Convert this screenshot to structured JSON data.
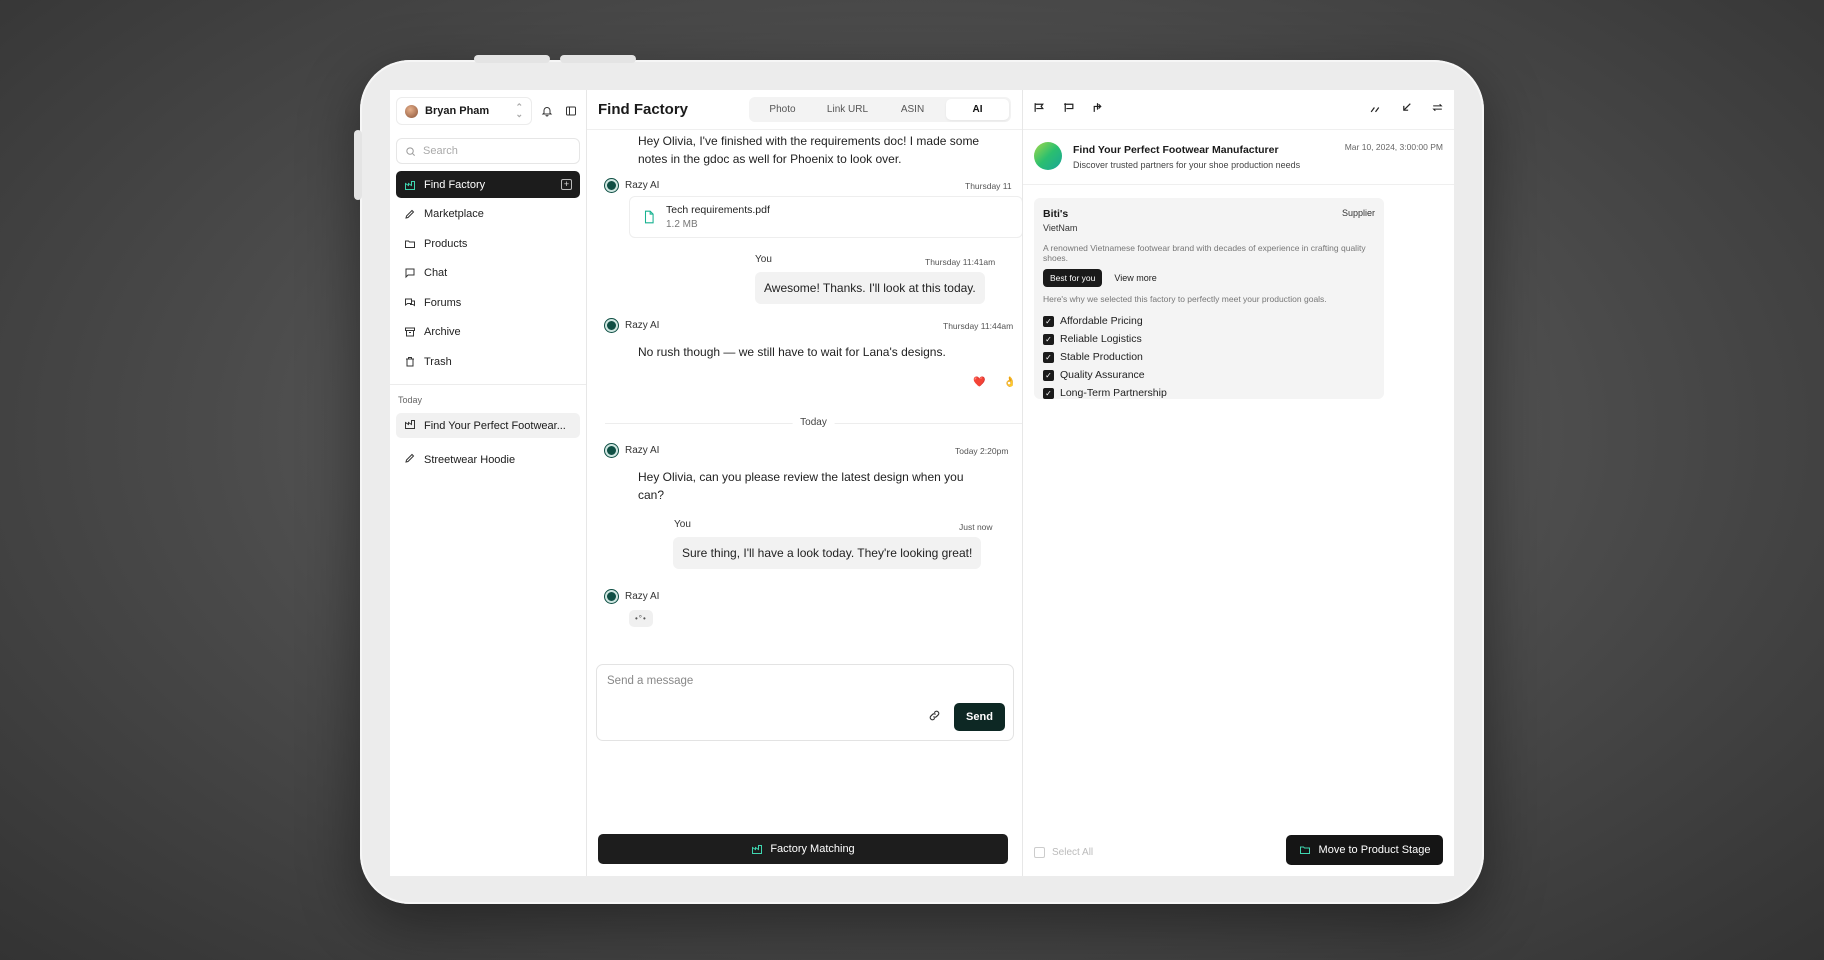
{
  "sidebar": {
    "user_name": "Bryan Pham",
    "search_placeholder": "Search",
    "items": [
      {
        "label": "Find Factory"
      },
      {
        "label": "Marketplace"
      },
      {
        "label": "Products"
      },
      {
        "label": "Chat"
      },
      {
        "label": "Forums"
      },
      {
        "label": "Archive"
      },
      {
        "label": "Trash"
      }
    ],
    "section_label": "Today",
    "recent": [
      {
        "label": "Find Your Perfect Footwear..."
      },
      {
        "label": "Streetwear Hoodie"
      }
    ]
  },
  "chat": {
    "title": "Find Factory",
    "tabs": [
      "Photo",
      "Link URL",
      "ASIN",
      "AI"
    ],
    "active_tab": "AI",
    "messages": {
      "m1_text": "Hey Olivia, I've finished with the requirements doc! I made some notes in the gdoc as well for Phoenix to look over.",
      "m2_sender": "Razy AI",
      "m2_time": "Thursday 11",
      "file_name": "Tech requirements.pdf",
      "file_size": "1.2 MB",
      "m3_sender": "You",
      "m3_time": "Thursday 11:41am",
      "m3_text": "Awesome! Thanks. I'll look at this today.",
      "m4_sender": "Razy AI",
      "m4_time": "Thursday 11:44am",
      "m4_text": "No rush though — we still have to wait for Lana's designs.",
      "reaction_1": "❤️",
      "reaction_2": "👌",
      "divider": "Today",
      "m5_sender": "Razy AI",
      "m5_time": "Today 2:20pm",
      "m5_text": "Hey Olivia, can you please review the latest design when you can?",
      "m6_sender": "You",
      "m6_time": "Just now",
      "m6_text": "Sure thing, I'll have a look today. They're looking great!",
      "m7_sender": "Razy AI",
      "typing": "•°•"
    },
    "composer_placeholder": "Send a message",
    "send_label": "Send",
    "factory_matching_label": "Factory Matching"
  },
  "panel": {
    "conv_title": "Find Your Perfect Footwear Manufacturer",
    "conv_subtitle": "Discover trusted partners for your shoe production needs",
    "conv_date": "Mar 10, 2024, 3:00:00 PM",
    "card": {
      "name": "Biti's",
      "tag": "Supplier",
      "country": "VietNam",
      "description": "A renowned Vietnamese footwear brand with decades of experience in crafting quality shoes.",
      "best_label": "Best for you",
      "view_more": "View more",
      "why": "Here's why we selected this factory to perfectly meet your production goals.",
      "features": [
        "Affordable Pricing",
        "Reliable Logistics",
        "Stable Production",
        "Quality Assurance",
        "Long-Term Partnership"
      ]
    },
    "select_all": "Select All",
    "move_label": "Move to Product Stage"
  },
  "colors": {
    "accent_dark": "#0d2824",
    "active_nav": "#1c1c1c",
    "icon_green": "#17b290"
  }
}
